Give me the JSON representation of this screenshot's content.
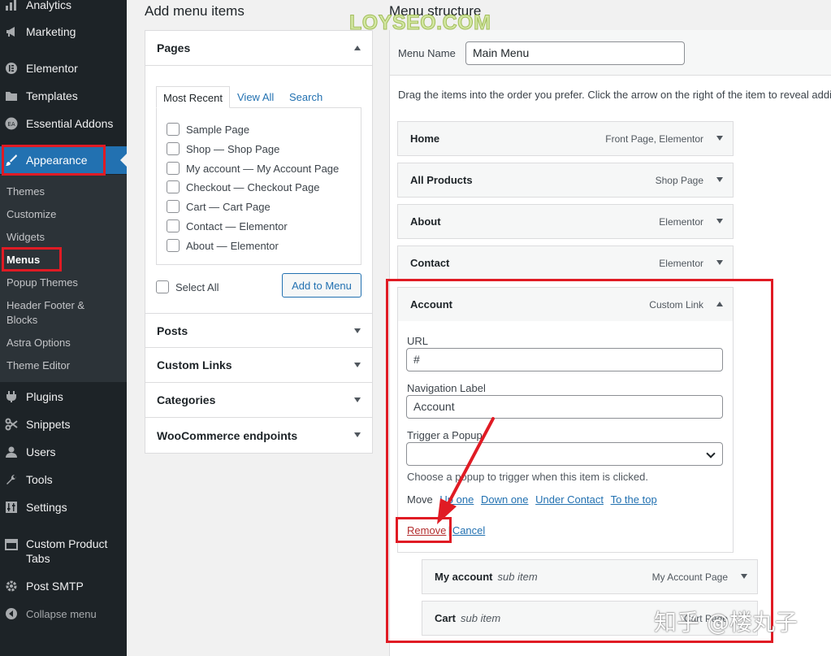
{
  "sidebar": {
    "items": [
      {
        "label": "Analytics",
        "icon": "bar-chart-icon"
      },
      {
        "label": "Marketing",
        "icon": "megaphone-icon"
      },
      {
        "label": "Elementor",
        "icon": "elementor-icon"
      },
      {
        "label": "Templates",
        "icon": "folder-icon"
      },
      {
        "label": "Essential Addons",
        "icon": "ea-icon"
      },
      {
        "label": "Appearance",
        "icon": "paintbrush-icon"
      },
      {
        "label": "Plugins",
        "icon": "plug-icon"
      },
      {
        "label": "Snippets",
        "icon": "scissors-icon"
      },
      {
        "label": "Users",
        "icon": "user-icon"
      },
      {
        "label": "Tools",
        "icon": "wrench-icon"
      },
      {
        "label": "Settings",
        "icon": "sliders-icon"
      },
      {
        "label": "Custom Product Tabs",
        "icon": "tabs-icon"
      },
      {
        "label": "Post SMTP",
        "icon": "gear-icon"
      }
    ],
    "submenu": [
      "Themes",
      "Customize",
      "Widgets",
      "Menus",
      "Popup Themes",
      "Header Footer & Blocks",
      "Astra Options",
      "Theme Editor"
    ],
    "collapse_label": "Collapse menu"
  },
  "left": {
    "title": "Add menu items",
    "pages_header": "Pages",
    "tabs": [
      "Most Recent",
      "View All",
      "Search"
    ],
    "pages": [
      {
        "title": "Sample Page",
        "sub": ""
      },
      {
        "title": "Shop —",
        "sub": "Shop Page"
      },
      {
        "title": "My account —",
        "sub": "My Account Page"
      },
      {
        "title": "Checkout —",
        "sub": "Checkout Page"
      },
      {
        "title": "Cart —",
        "sub": "Cart Page"
      },
      {
        "title": "Contact —",
        "sub": "Elementor"
      },
      {
        "title": "About —",
        "sub": "Elementor"
      }
    ],
    "select_all": "Select All",
    "add_button": "Add to Menu",
    "sections": [
      "Posts",
      "Custom Links",
      "Categories",
      "WooCommerce endpoints"
    ]
  },
  "right": {
    "title": "Menu structure",
    "menu_name_label": "Menu Name",
    "menu_name_value": "Main Menu",
    "instructions": "Drag the items into the order you prefer. Click the arrow on the right of the item to reveal additional configuration options.",
    "items": [
      {
        "label": "Home",
        "type": "Front Page, Elementor"
      },
      {
        "label": "All Products",
        "type": "Shop Page"
      },
      {
        "label": "About",
        "type": "Elementor"
      },
      {
        "label": "Contact",
        "type": "Elementor"
      },
      {
        "label": "Account",
        "type": "Custom Link"
      }
    ],
    "settings": {
      "url_label": "URL",
      "url_value": "#",
      "nav_label": "Navigation Label",
      "nav_value": "Account",
      "popup_label": "Trigger a Popup",
      "popup_value": "",
      "note": "Choose a popup to trigger when this item is clicked.",
      "move_label": "Move",
      "move_links": [
        "Up one",
        "Down one",
        "Under Contact",
        "To the top"
      ],
      "remove": "Remove",
      "separator": "|",
      "cancel": "Cancel"
    },
    "sub_items": [
      {
        "label": "My account",
        "tag": "sub item",
        "type": "My Account Page"
      },
      {
        "label": "Cart",
        "tag": "sub item",
        "type": "Cart Page"
      }
    ]
  },
  "watermarks": {
    "brand": "LOYSEO.COM",
    "zhihu": "知乎 @楼丸子"
  },
  "colors": {
    "highlight": "#e01b24",
    "accent": "#2271b1",
    "sidebar": "#1d2327"
  }
}
